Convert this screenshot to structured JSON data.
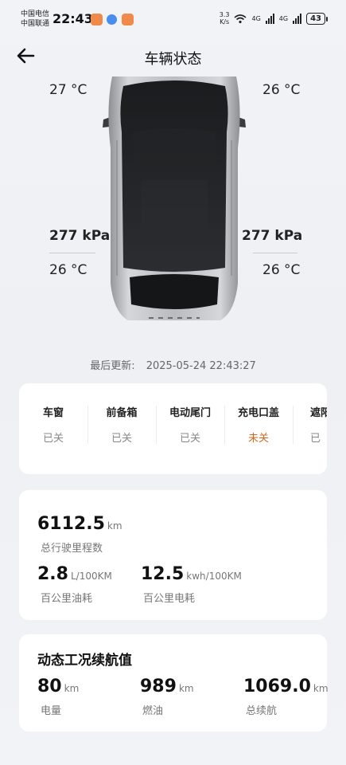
{
  "status_bar": {
    "carrier1": "中国电信",
    "carrier2": "中国联通",
    "time": "22:43",
    "net_speed_value": "3.3",
    "net_speed_unit": "K/s",
    "sig1_label": "4G",
    "sig2_label": "4G",
    "battery": "43"
  },
  "header": {
    "title": "车辆状态",
    "back_icon": "back-arrow-icon"
  },
  "tires": {
    "front_left_temp": "27 °C",
    "front_right_temp": "26 °C",
    "rear_left_pressure": "277 kPa",
    "rear_right_pressure": "277 kPa",
    "rear_left_temp": "26 °C",
    "rear_right_temp": "26 °C"
  },
  "last_update": {
    "label": "最后更新:",
    "value": "2025-05-24 22:43:27"
  },
  "status_items": [
    {
      "label": "车窗",
      "value": "已关"
    },
    {
      "label": "前备箱",
      "value": "已关"
    },
    {
      "label": "电动尾门",
      "value": "已关"
    },
    {
      "label": "充电口盖",
      "value": "未关"
    },
    {
      "label": "遮阳",
      "value": "已"
    }
  ],
  "mileage": {
    "total_value": "6112.5",
    "total_unit": "km",
    "total_label": "总行驶里程数",
    "fuel_value": "2.8",
    "fuel_unit": "L/100KM",
    "fuel_label": "百公里油耗",
    "elec_value": "12.5",
    "elec_unit": "kwh/100KM",
    "elec_label": "百公里电耗"
  },
  "dynamic_range": {
    "title": "动态工况续航值",
    "elec_value": "80",
    "elec_unit": "km",
    "elec_label": "电量",
    "fuel_value": "989",
    "fuel_unit": "km",
    "fuel_label": "燃油",
    "total_value": "1069.0",
    "total_unit": "km",
    "total_label": "总续航"
  },
  "colors": {
    "warning": "#d2691e",
    "card": "#ffffff",
    "background": "#f2f3f7"
  }
}
